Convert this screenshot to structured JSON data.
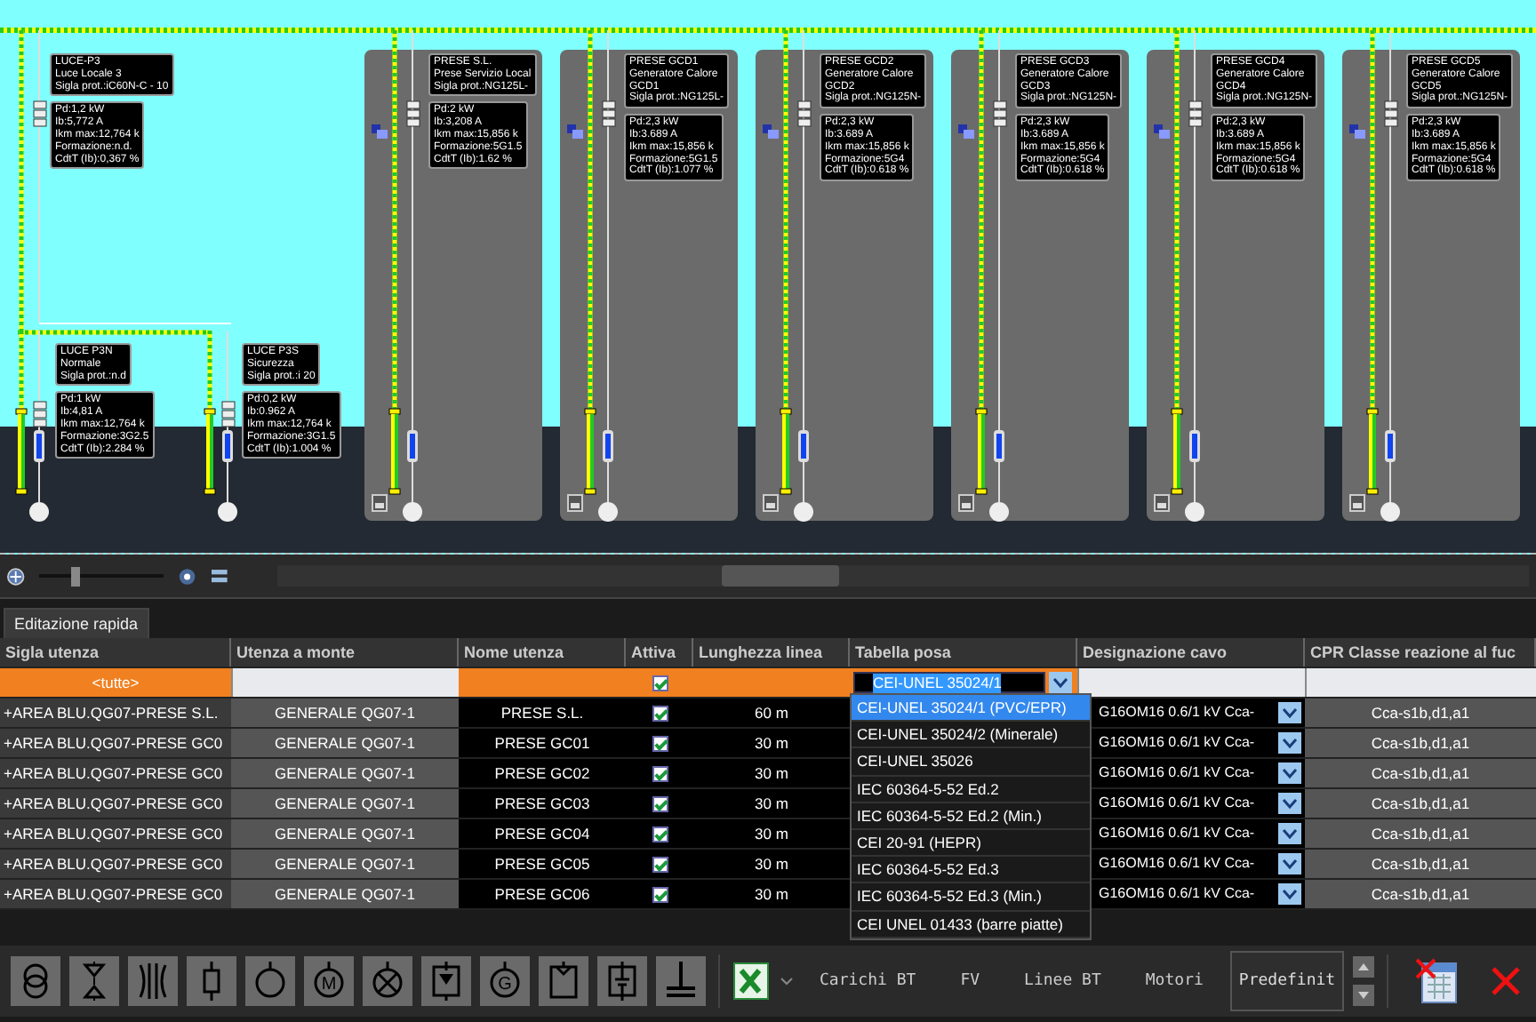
{
  "diagram": {
    "feeders": [
      {
        "kind": "free",
        "label": [
          "LUCE-P3",
          "Luce Locale 3",
          "Sigla prot.:iC60N-C - 10"
        ],
        "info": [
          "Pd:1,2 kW",
          "Ib:5,772 A",
          "Ikm max:12,764 k",
          "Formazione:n.d.",
          "CdtT (Ib):0,367 %"
        ]
      },
      {
        "kind": "free",
        "label": [
          "LUCE P3N",
          "Normale",
          "Sigla prot.:n.d"
        ],
        "info": [
          "Pd:1 kW",
          "Ib:4,81 A",
          "Ikm max:12,764 k",
          "Formazione:3G2.5",
          "CdtT (Ib):2.284 %"
        ]
      },
      {
        "kind": "free",
        "label": [
          "LUCE P3S",
          "Sicurezza",
          "Sigla prot.:i 20"
        ],
        "info": [
          "Pd:0,2 kW",
          "Ib:0.962 A",
          "Ikm max:12,764 k",
          "Formazione:3G1.5",
          "CdtT (Ib):1.004 %"
        ]
      },
      {
        "kind": "panel",
        "label": [
          "PRESE S.L.",
          "Prese Servizio Local",
          "Sigla prot.:NG125L-"
        ],
        "info": [
          "Pd:2 kW",
          "Ib:3,208 A",
          "Ikm max:15,856 k",
          "Formazione:5G1.5",
          "CdtT (Ib):1.62 %"
        ]
      },
      {
        "kind": "panel",
        "label": [
          "PRESE GCD1",
          "Generatore Calore",
          "GCD1",
          "Sigla prot.:NG125L-"
        ],
        "info": [
          "Pd:2,3 kW",
          "Ib:3.689 A",
          "Ikm max:15,856 k",
          "Formazione:5G1.5",
          "CdtT (Ib):1.077 %"
        ]
      },
      {
        "kind": "panel",
        "label": [
          "PRESE GCD2",
          "Generatore Calore",
          "GCD2",
          "Sigla prot.:NG125N-"
        ],
        "info": [
          "Pd:2,3 kW",
          "Ib:3.689 A",
          "Ikm max:15,856 k",
          "Formazione:5G4",
          "CdtT (Ib):0.618 %"
        ]
      },
      {
        "kind": "panel",
        "label": [
          "PRESE GCD3",
          "Generatore Calore",
          "GCD3",
          "Sigla prot.:NG125N-"
        ],
        "info": [
          "Pd:2,3 kW",
          "Ib:3.689 A",
          "Ikm max:15,856 k",
          "Formazione:5G4",
          "CdtT (Ib):0.618 %"
        ]
      },
      {
        "kind": "panel",
        "label": [
          "PRESE GCD4",
          "Generatore Calore",
          "GCD4",
          "Sigla prot.:NG125N-"
        ],
        "info": [
          "Pd:2,3 kW",
          "Ib:3.689 A",
          "Ikm max:15,856 k",
          "Formazione:5G4",
          "CdtT (Ib):0.618 %"
        ]
      },
      {
        "kind": "panel",
        "label": [
          "PRESE GCD5",
          "Generatore Calore",
          "GCD5",
          "Sigla prot.:NG125N-"
        ],
        "info": [
          "Pd:2,3 kW",
          "Ib:3.689 A",
          "Ikm max:15,856 k",
          "Formazione:5G4",
          "CdtT (Ib):0.618 %"
        ]
      }
    ]
  },
  "view_toolbar": {
    "zoom": {
      "level": 0.25
    }
  },
  "tabs": [
    {
      "label": "Editazione rapida",
      "selected": true
    }
  ],
  "table": {
    "columns": [
      "Sigla utenza",
      "Utenza a monte",
      "Nome utenza",
      "Attiva",
      "Lunghezza linea",
      "Tabella posa",
      "Designazione cavo",
      "CPR Classe reazione al fuc"
    ],
    "filter_row": {
      "sigla": "<tutte>",
      "attiva_checked": true,
      "tabella_posa": "CEI-UNEL 35024/1"
    },
    "rows": [
      {
        "sigla": "+AREA BLU.QG07-PRESE S.L.",
        "utenza_a_monte": "GENERALE QG07-1",
        "nome": "PRESE S.L.",
        "attiva": true,
        "lunghezza": "60 m",
        "designazione": "G16OM16 0.6/1 kV Cca-",
        "cpr": "Cca-s1b,d1,a1"
      },
      {
        "sigla": "+AREA BLU.QG07-PRESE GC0",
        "utenza_a_monte": "GENERALE QG07-1",
        "nome": "PRESE GC01",
        "attiva": true,
        "lunghezza": "30 m",
        "designazione": "G16OM16 0.6/1 kV Cca-",
        "cpr": "Cca-s1b,d1,a1"
      },
      {
        "sigla": "+AREA BLU.QG07-PRESE GC0",
        "utenza_a_monte": "GENERALE QG07-1",
        "nome": "PRESE GC02",
        "attiva": true,
        "lunghezza": "30 m",
        "designazione": "G16OM16 0.6/1 kV Cca-",
        "cpr": "Cca-s1b,d1,a1"
      },
      {
        "sigla": "+AREA BLU.QG07-PRESE GC0",
        "utenza_a_monte": "GENERALE QG07-1",
        "nome": "PRESE GC03",
        "attiva": true,
        "lunghezza": "30 m",
        "designazione": "G16OM16 0.6/1 kV Cca-",
        "cpr": "Cca-s1b,d1,a1"
      },
      {
        "sigla": "+AREA BLU.QG07-PRESE GC0",
        "utenza_a_monte": "GENERALE QG07-1",
        "nome": "PRESE GC04",
        "attiva": true,
        "lunghezza": "30 m",
        "designazione": "G16OM16 0.6/1 kV Cca-",
        "cpr": "Cca-s1b,d1,a1"
      },
      {
        "sigla": "+AREA BLU.QG07-PRESE GC0",
        "utenza_a_monte": "GENERALE QG07-1",
        "nome": "PRESE GC05",
        "attiva": true,
        "lunghezza": "30 m",
        "designazione": "G16OM16 0.6/1 kV Cca-",
        "cpr": "Cca-s1b,d1,a1"
      },
      {
        "sigla": "+AREA BLU.QG07-PRESE GC0",
        "utenza_a_monte": "GENERALE QG07-1",
        "nome": "PRESE GC06",
        "attiva": true,
        "lunghezza": "30 m",
        "designazione": "G16OM16 0.6/1 kV Cca-",
        "cpr": "Cca-s1b,d1,a1"
      }
    ]
  },
  "dropdown": {
    "options": [
      {
        "label": "CEI-UNEL 35024/1 (PVC/EPR)",
        "selected": true
      },
      {
        "label": "CEI-UNEL 35024/2 (Minerale)",
        "selected": false
      },
      {
        "label": "CEI-UNEL 35026",
        "selected": false
      },
      {
        "label": "IEC 60364-5-52 Ed.2",
        "selected": false
      },
      {
        "label": "IEC 60364-5-52 Ed.2 (Min.)",
        "selected": false
      },
      {
        "label": "CEI 20-91 (HEPR)",
        "selected": false
      },
      {
        "label": "IEC 60364-5-52 Ed.3",
        "selected": false
      },
      {
        "label": "IEC 60364-5-52 Ed.3 (Min.)",
        "selected": false
      },
      {
        "label": "CEI UNEL 01433 (barre piatte)",
        "selected": false
      }
    ]
  },
  "bottom_toolbar": {
    "symbols": [
      {
        "kind": "transformer"
      },
      {
        "kind": "triangles"
      },
      {
        "kind": "brackets"
      },
      {
        "kind": "resistor"
      },
      {
        "kind": "circle"
      },
      {
        "kind": "lettered",
        "letter": "M"
      },
      {
        "kind": "lamp"
      },
      {
        "kind": "boxarrow"
      },
      {
        "kind": "lettered",
        "letter": "G"
      },
      {
        "kind": "boxnotch"
      },
      {
        "kind": "battery"
      },
      {
        "kind": "ground"
      }
    ],
    "categories": [
      "Carichi BT",
      "FV",
      "Linee BT",
      "Motori"
    ],
    "preset": "Predefinit"
  }
}
